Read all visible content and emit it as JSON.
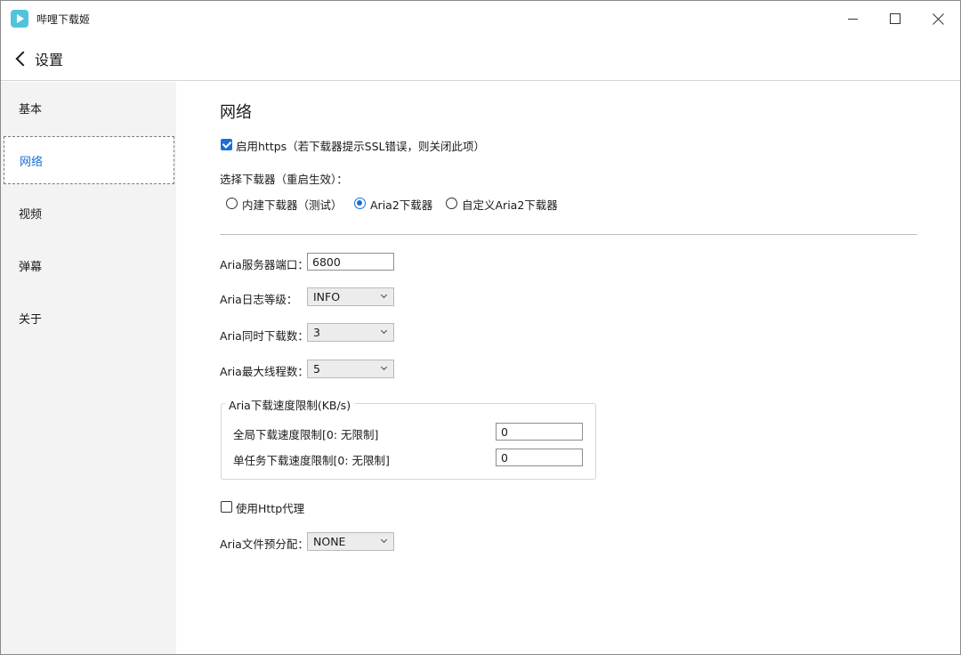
{
  "app": {
    "title": "哔哩下载姬"
  },
  "header": {
    "back_label": "设置"
  },
  "sidebar": {
    "items": [
      {
        "label": "基本"
      },
      {
        "label": "网络"
      },
      {
        "label": "视频"
      },
      {
        "label": "弹幕"
      },
      {
        "label": "关于"
      }
    ],
    "active": "网络"
  },
  "network": {
    "section_title": "网络",
    "https": {
      "label": "启用https（若下载器提示SSL错误，则关闭此项）",
      "checked": true
    },
    "downloader": {
      "label": "选择下载器（重启生效）：",
      "options": [
        "内建下载器（测试）",
        "Aria2下载器",
        "自定义Aria2下载器"
      ],
      "selected": "Aria2下载器"
    },
    "aria_port": {
      "label": "Aria服务器端口：",
      "value": "6800"
    },
    "aria_log_level": {
      "label": "Aria日志等级：",
      "value": "INFO"
    },
    "aria_concurrent": {
      "label": "Aria同时下载数：",
      "value": "3"
    },
    "aria_max_threads": {
      "label": "Aria最大线程数：",
      "value": "5"
    },
    "speed_limit": {
      "title": "Aria下载速度限制(KB/s)",
      "global_label": "全局下载速度限制[0: 无限制]",
      "global_value": "0",
      "single_label": "单任务下载速度限制[0: 无限制]",
      "single_value": "0"
    },
    "http_proxy": {
      "label": "使用Http代理",
      "checked": false
    },
    "file_alloc": {
      "label": "Aria文件预分配：",
      "value": "NONE"
    }
  },
  "colors": {
    "accent": "#1a6fd6",
    "sidebar_bg": "#f3f3f3",
    "logo": "#52c3dc"
  }
}
